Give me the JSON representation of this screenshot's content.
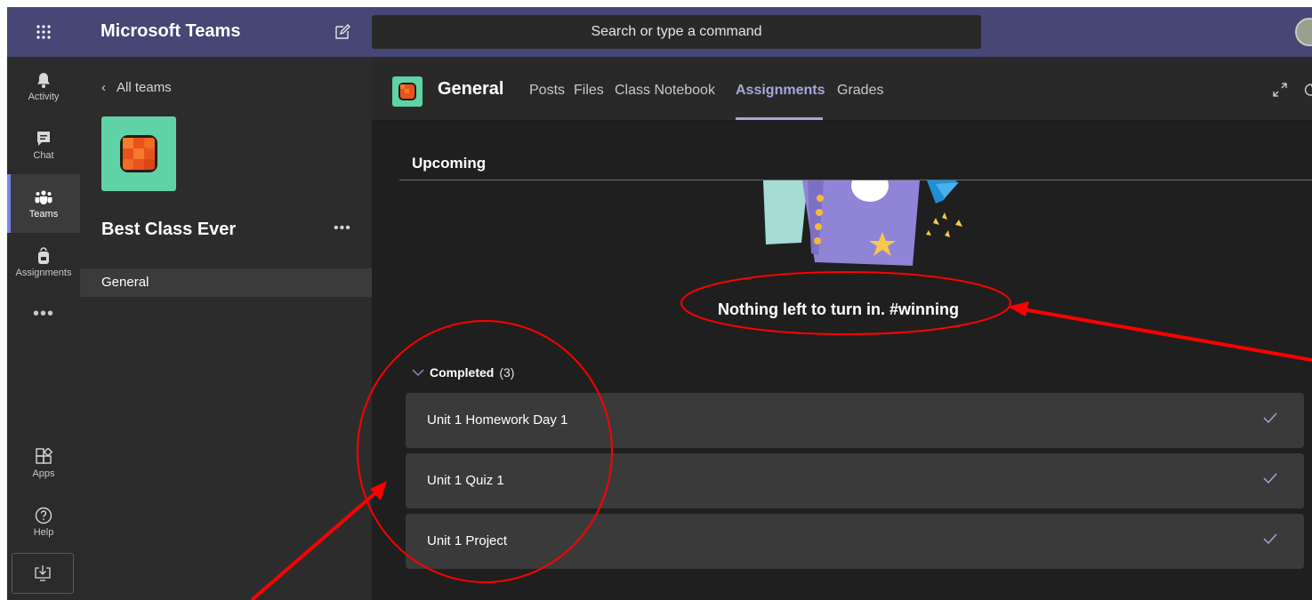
{
  "app": {
    "title": "Microsoft Teams"
  },
  "search": {
    "placeholder": "Search or type a command"
  },
  "rail": {
    "items": [
      {
        "label": "Activity",
        "icon": "bell-icon"
      },
      {
        "label": "Chat",
        "icon": "chat-icon"
      },
      {
        "label": "Teams",
        "icon": "teams-icon"
      },
      {
        "label": "Assignments",
        "icon": "backpack-icon"
      },
      {
        "label": "Apps",
        "icon": "apps-icon"
      },
      {
        "label": "Help",
        "icon": "help-icon"
      }
    ],
    "more": "•••",
    "active": "Teams"
  },
  "teams_panel": {
    "back_label": "All teams",
    "team_name": "Best Class Ever",
    "more": "•••",
    "channels": [
      "General"
    ]
  },
  "channel": {
    "title": "General",
    "tabs": [
      "Posts",
      "Files",
      "Class Notebook",
      "Assignments",
      "Grades"
    ],
    "active_tab": "Assignments"
  },
  "assignments": {
    "upcoming_label": "Upcoming",
    "empty_message": "Nothing left to turn in. #winning",
    "completed_label": "Completed",
    "completed_count": "(3)",
    "completed": [
      {
        "title": "Unit 1 Homework Day 1"
      },
      {
        "title": "Unit 1 Quiz 1"
      },
      {
        "title": "Unit 1 Project"
      }
    ]
  },
  "colors": {
    "topbar": "#464775",
    "accent": "#a6a7dc",
    "annotation": "#ff0000",
    "team_logo_bg": "#5fd3a6"
  }
}
